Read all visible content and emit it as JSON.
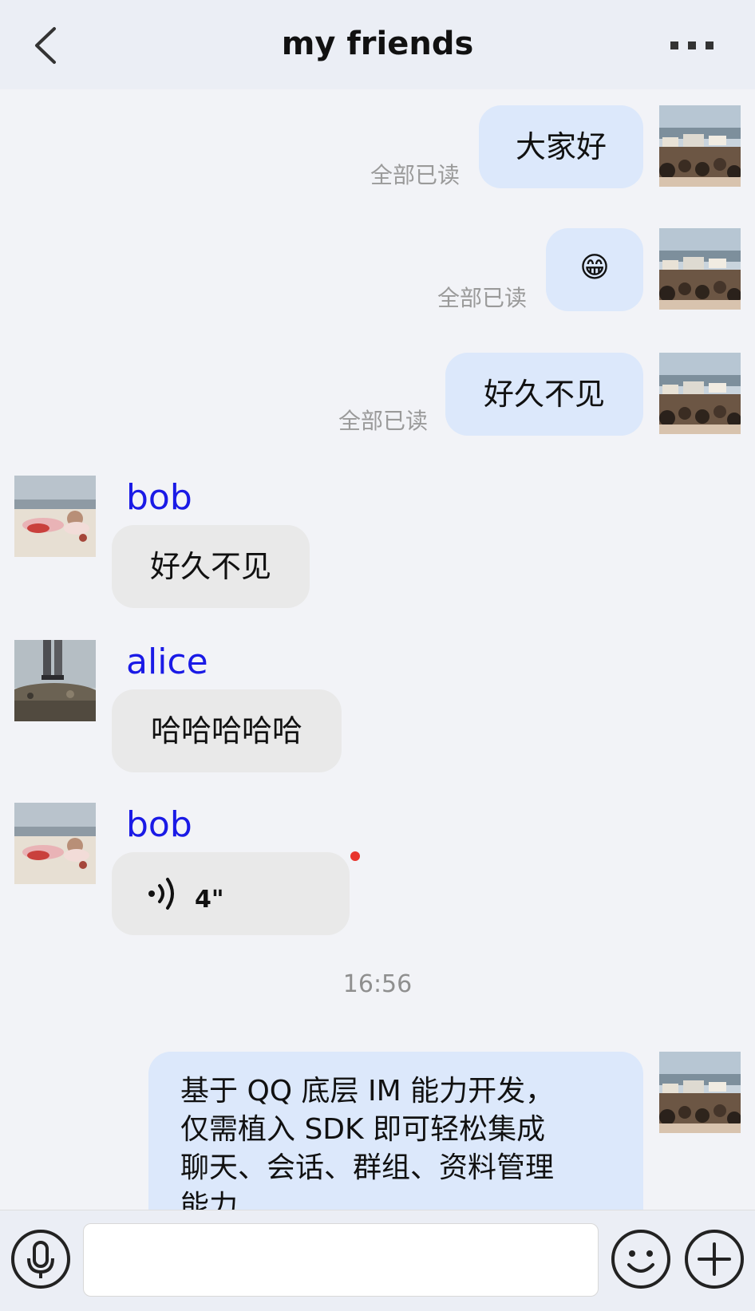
{
  "header": {
    "title": "my friends"
  },
  "messages": [
    {
      "type": "text",
      "side": "right",
      "text": "大家好",
      "status": "全部已读",
      "avatar": "crowd-photo"
    },
    {
      "type": "emoji",
      "side": "right",
      "emoji": "😁",
      "status": "全部已读",
      "avatar": "crowd-photo"
    },
    {
      "type": "text",
      "side": "right",
      "text": "好久不见",
      "status": "全部已读",
      "avatar": "crowd-photo"
    },
    {
      "type": "text",
      "side": "left",
      "sender": "bob",
      "text": "好久不见",
      "avatar": "beach-photo"
    },
    {
      "type": "text",
      "side": "left",
      "sender": "alice",
      "text": "哈哈哈哈哈",
      "avatar": "legs-photo"
    },
    {
      "type": "voice",
      "side": "left",
      "sender": "bob",
      "duration": "4\"",
      "unread": true,
      "avatar": "beach-photo"
    },
    {
      "type": "time",
      "text": "16:56"
    },
    {
      "type": "text",
      "side": "right",
      "lines": [
        "基于 QQ 底层 IM 能力开发，",
        "仅需植入 SDK 即可轻松集成",
        "聊天、会话、群组、资料管理",
        "能力"
      ],
      "avatar": "crowd-photo"
    }
  ],
  "input": {
    "value": "",
    "placeholder": ""
  },
  "colors": {
    "mine_bubble": "#dce8fb",
    "their_bubble": "#e9e9e9",
    "sender_name": "#1a1ae6",
    "unread_dot": "#e8342c"
  },
  "icons": {
    "back": "chevron-left-icon",
    "more": "more-dots-icon",
    "voice": "microphone-icon",
    "emoji": "smiley-icon",
    "plus": "plus-icon"
  }
}
